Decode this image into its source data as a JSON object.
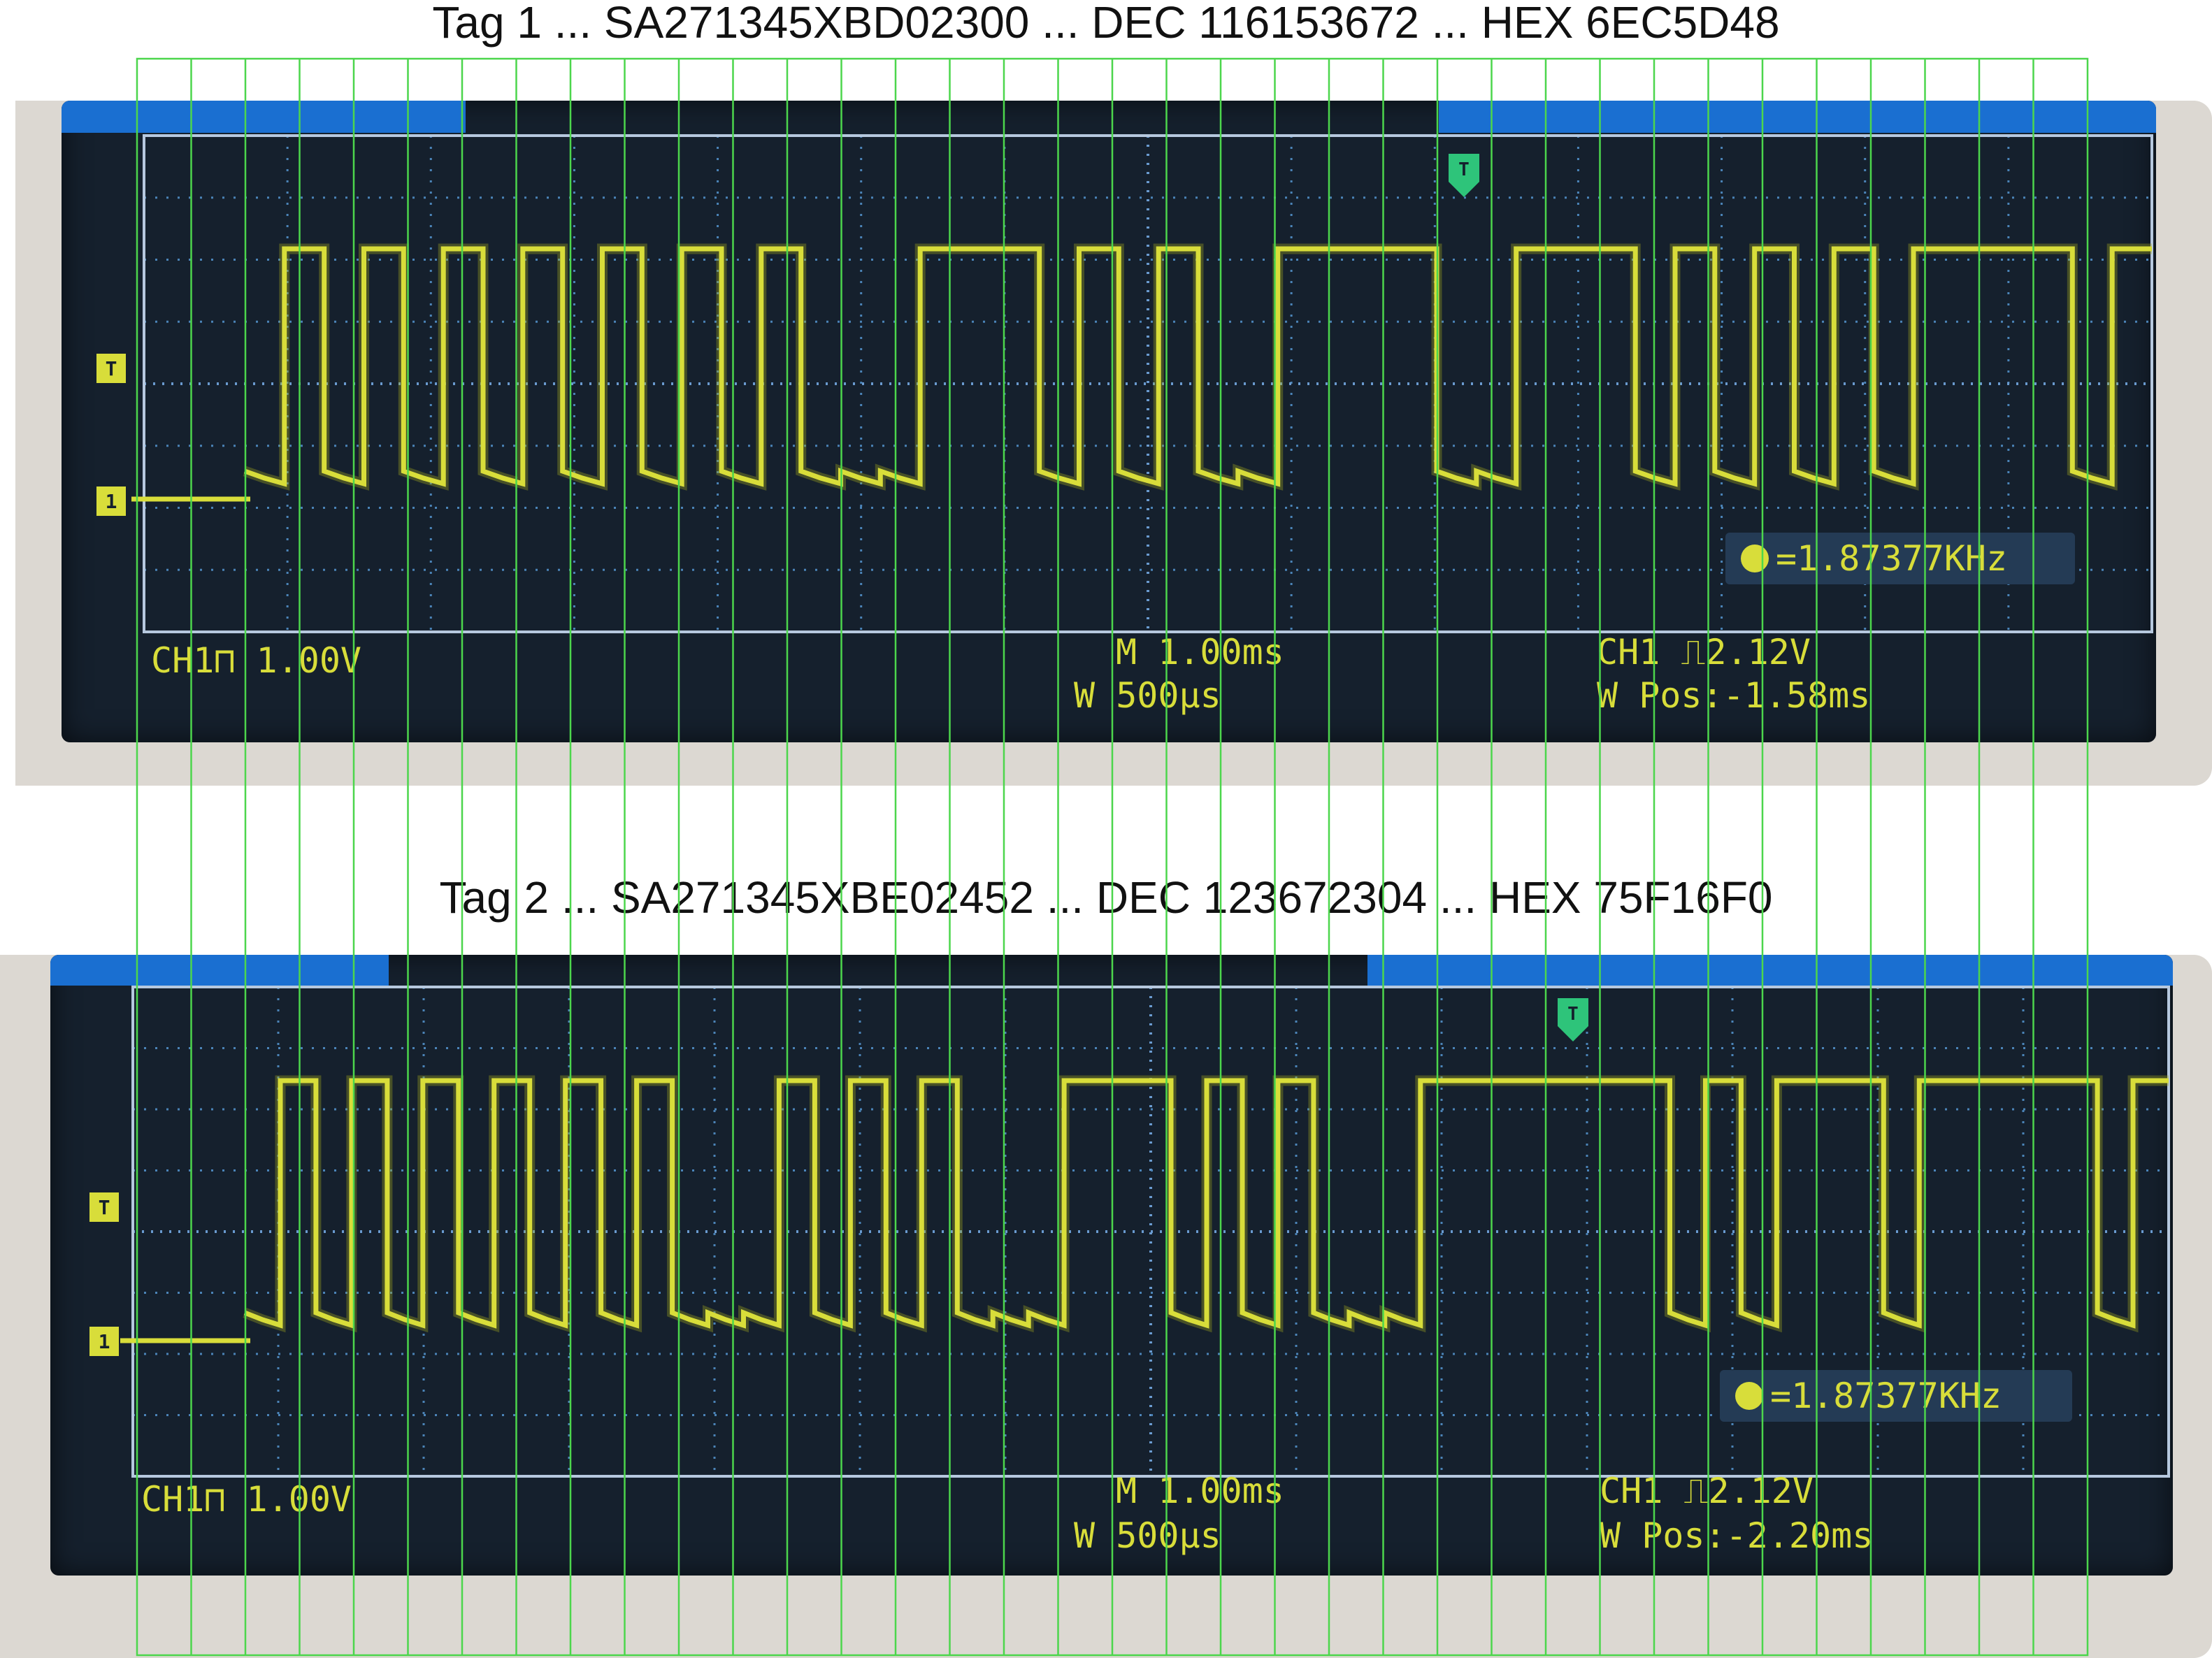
{
  "chart_data": [
    {
      "type": "line",
      "title": "Tag 1 ... SA271345XBD02300 ... DEC 116153672 ... HEX 6EC5D48",
      "levels": [
        0,
        1,
        0,
        1,
        0,
        1,
        0,
        1,
        0,
        1,
        0,
        1,
        0,
        1,
        0,
        0,
        0,
        1,
        1,
        1,
        0,
        1,
        0,
        1,
        0,
        0,
        1,
        1,
        1,
        1,
        0,
        0,
        1,
        1,
        1,
        0,
        1,
        0,
        1,
        0,
        1,
        0,
        1,
        1,
        1,
        1,
        0,
        1
      ],
      "scope": {
        "ch1_scale": "CH1⊓ 1.00V",
        "main_timebase": "M 1.00ms",
        "window_timebase": "W 500μs",
        "trigger": "CH1 ⎍2.12V",
        "window_pos": "W Pos:-1.58ms",
        "frequency": "=1.87377KHz",
        "trigger_marker": "T",
        "ground_marker": "1",
        "window_marker": "T"
      }
    },
    {
      "type": "line",
      "title": "Tag 2 ... SA271345XBE02452 ... DEC 123672304 ... HEX 75F16F0",
      "levels": [
        0,
        1,
        0,
        1,
        0,
        1,
        0,
        1,
        0,
        1,
        0,
        1,
        0,
        0,
        0,
        1,
        0,
        1,
        0,
        1,
        0,
        0,
        0,
        1,
        1,
        1,
        0,
        1,
        0,
        1,
        0,
        0,
        0,
        1,
        1,
        1,
        1,
        1,
        1,
        1,
        0,
        1,
        0,
        1,
        1,
        1,
        0,
        1,
        1,
        1,
        1,
        1,
        0,
        1
      ],
      "scope": {
        "ch1_scale": "CH1⊓ 1.00V",
        "main_timebase": "M 1.00ms",
        "window_timebase": "W 500μs",
        "trigger": "CH1 ⎍2.12V",
        "window_pos": "W Pos:-2.20ms",
        "frequency": "=1.87377KHz",
        "trigger_marker": "T",
        "ground_marker": "1",
        "window_marker": "T"
      }
    }
  ],
  "bit_grid": {
    "lines": 37
  },
  "colors": {
    "trace": "#d8dd3a",
    "grid": "#4b84b8",
    "bit_lines": "#4cd64c",
    "screen": "#15202d",
    "top_bar": "#1a6fd1"
  }
}
